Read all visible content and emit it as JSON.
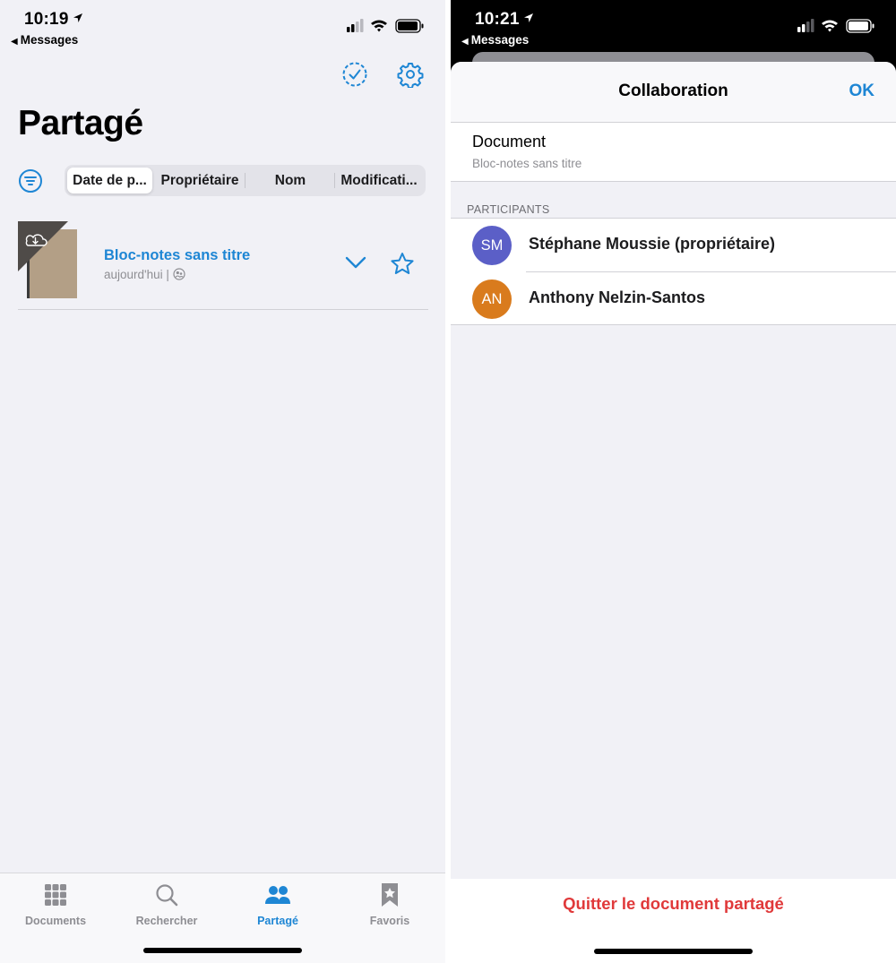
{
  "left": {
    "status": {
      "time": "10:19",
      "back_app": "Messages"
    },
    "title": "Partagé",
    "segments": [
      "Date de p...",
      "Propriétaire",
      "Nom",
      "Modificati..."
    ],
    "document": {
      "title": "Bloc-notes sans titre",
      "meta": "aujourd'hui |"
    },
    "tabs": [
      {
        "label": "Documents",
        "icon": "grid-icon"
      },
      {
        "label": "Rechercher",
        "icon": "search-icon"
      },
      {
        "label": "Partagé",
        "icon": "people-icon"
      },
      {
        "label": "Favoris",
        "icon": "bookmark-star-icon"
      }
    ]
  },
  "right": {
    "status": {
      "time": "10:21",
      "back_app": "Messages"
    },
    "sheet_title": "Collaboration",
    "ok_label": "OK",
    "document_label": "Document",
    "document_name": "Bloc-notes sans titre",
    "participants_header": "PARTICIPANTS",
    "participants": [
      {
        "initials": "SM",
        "name": "Stéphane Moussie (propriétaire)",
        "color": "#5b5fc7"
      },
      {
        "initials": "AN",
        "name": "Anthony Nelzin-Santos",
        "color": "#d97b1d"
      }
    ],
    "quit_label": "Quitter le document partagé"
  },
  "colors": {
    "accent": "#1e86d4",
    "destructive": "#e0393a"
  }
}
